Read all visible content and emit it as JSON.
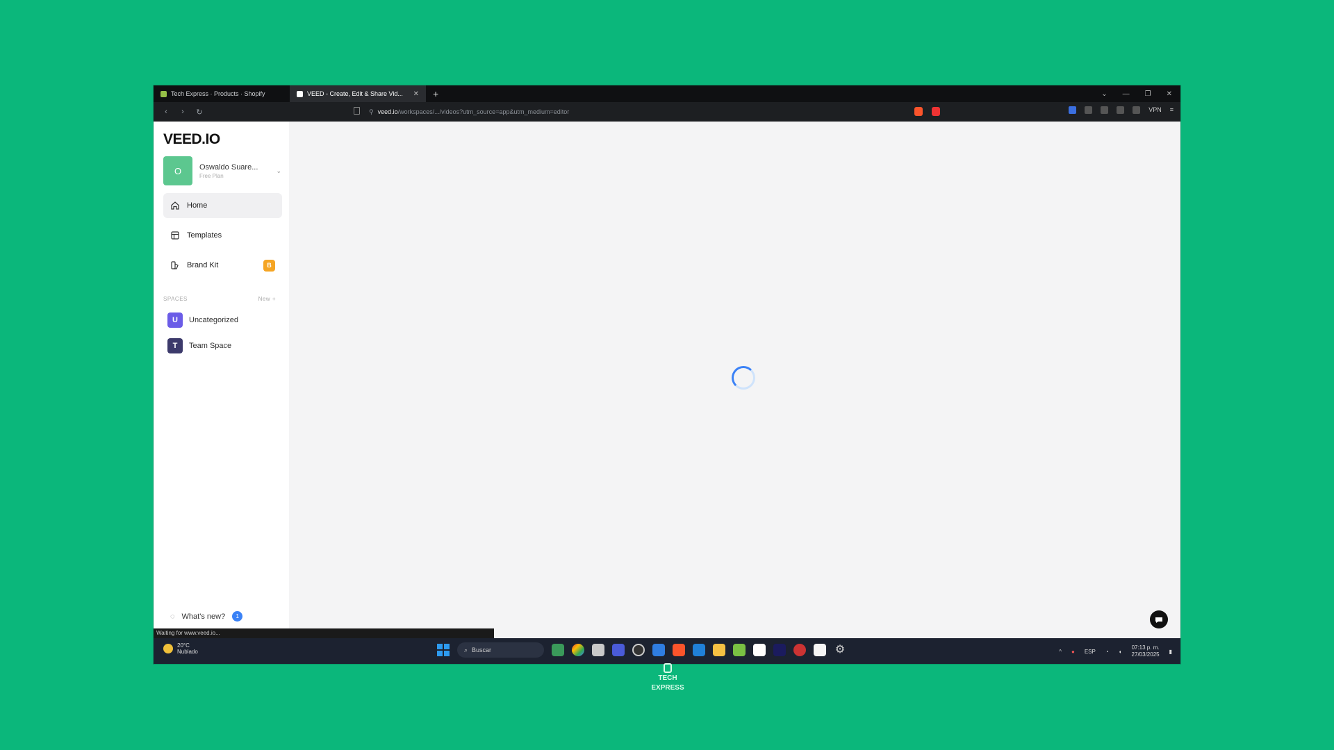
{
  "browser": {
    "tabs": [
      {
        "title": "Tech Express · Products · Shopify",
        "favicon_color": "#95bf47"
      },
      {
        "title": "VEED - Create, Edit & Share Vid...",
        "favicon_color": "#111111"
      }
    ],
    "url_host": "veed.io",
    "url_path": "/workspaces/.../videos?utm_source=app&utm_medium=editor",
    "vpn_label": "VPN"
  },
  "app": {
    "logo": "VEED.IO",
    "workspace": {
      "initial": "O",
      "name": "Oswaldo Suare...",
      "plan": "Free Plan"
    },
    "nav": [
      {
        "label": "Home",
        "icon": "home-icon"
      },
      {
        "label": "Templates",
        "icon": "templates-icon"
      },
      {
        "label": "Brand Kit",
        "icon": "brand-kit-icon",
        "badge": "B"
      }
    ],
    "spaces_header": "SPACES",
    "spaces_new": "New",
    "spaces": [
      {
        "initial": "U",
        "label": "Uncategorized",
        "color": "#6b5ce7"
      },
      {
        "initial": "T",
        "label": "Team Space",
        "color": "#3c3a6b"
      }
    ],
    "whats_new": "What's new?",
    "whats_new_count": "1",
    "status_text": "Waiting for www.veed.io..."
  },
  "taskbar": {
    "weather_temp": "20°C",
    "weather_desc": "Nublado",
    "search_placeholder": "Buscar",
    "lang": "ESP",
    "time": "07:13 p. m.",
    "date": "27/03/2025"
  },
  "watermark": {
    "line1": "TECH",
    "line2": "EXPRESS"
  },
  "colors": {
    "background": "#0bb77b",
    "accent": "#3b82f6"
  }
}
